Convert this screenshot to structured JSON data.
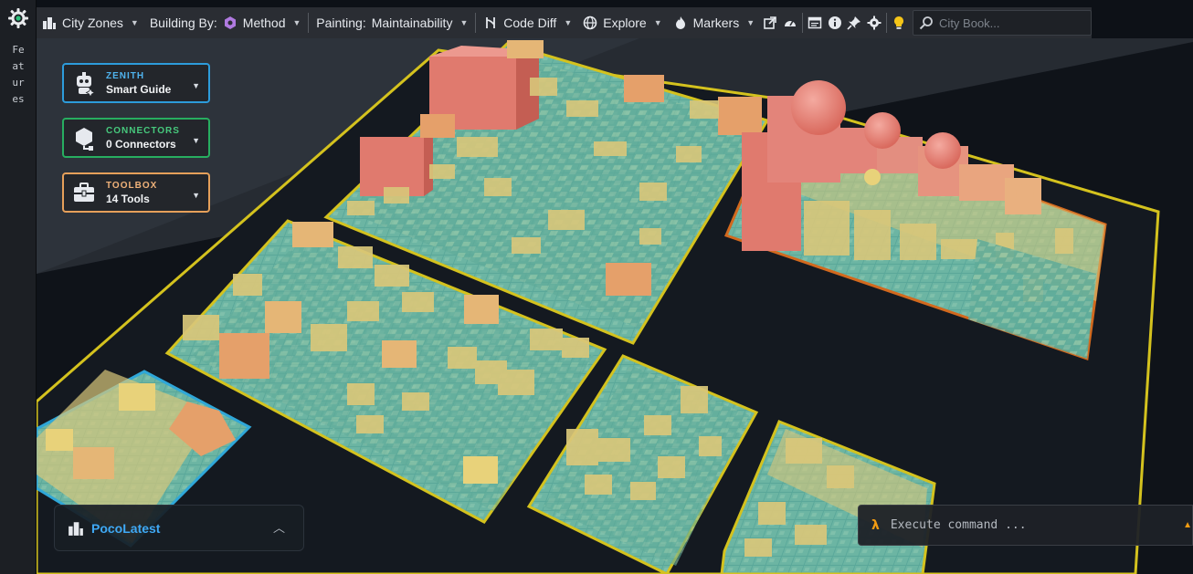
{
  "sidebar": {
    "vertical_label": "Features",
    "logo_icon": "gear-logo-icon"
  },
  "toolbar": {
    "city_zones": "City Zones",
    "building_by_label": "Building By:",
    "building_by_value": "Method",
    "painting_label": "Painting:",
    "painting_value": "Maintainability",
    "code_diff": "Code Diff",
    "explore": "Explore",
    "markers": "Markers",
    "search_placeholder": "City Book..."
  },
  "cards": {
    "zenith": {
      "title": "ZENITH",
      "subtitle": "Smart Guide",
      "icon": "robot-icon"
    },
    "connectors": {
      "title": "CONNECTORS",
      "subtitle": "0 Connectors",
      "icon": "plug-icon"
    },
    "toolbox": {
      "title": "TOOLBOX",
      "subtitle": "14 Tools",
      "icon": "toolbox-icon"
    }
  },
  "project_panel": {
    "name": "PocoLatest"
  },
  "command_bar": {
    "placeholder": "Execute command ...",
    "prefix": "λ"
  },
  "colors": {
    "zone_border": "#d4c21e",
    "selected_zone_border": "#2fa7d8",
    "hot_zone_border": "#d2691e",
    "good": "#5aa89a",
    "medium": "#d9c77a",
    "poor": "#e07a6e"
  }
}
